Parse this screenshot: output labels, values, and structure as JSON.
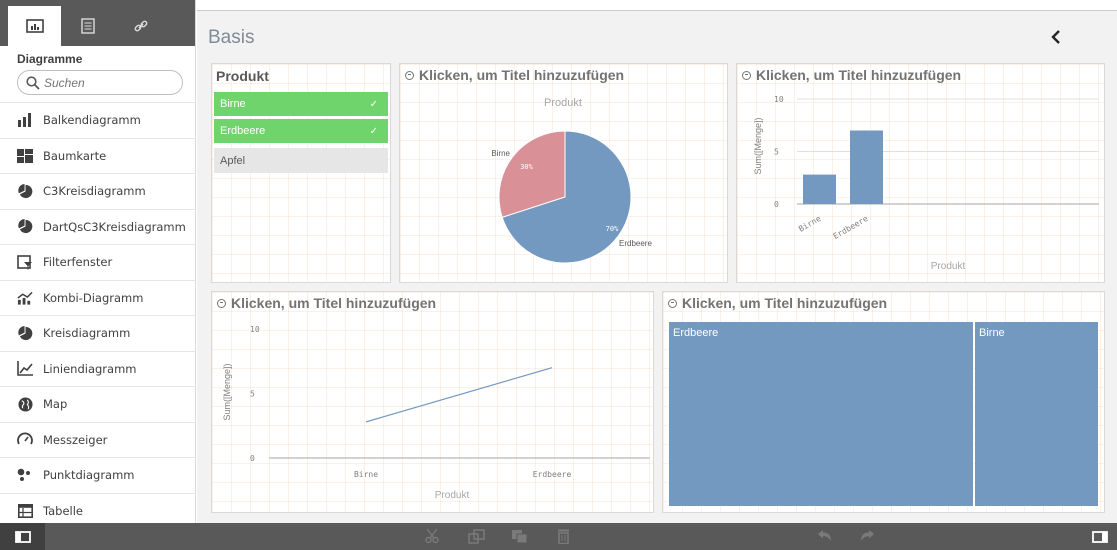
{
  "sidebar": {
    "tabs": [
      "charts-icon",
      "master-items-icon",
      "fields-link-icon"
    ],
    "title": "Diagramme",
    "search_placeholder": "Suchen",
    "items": [
      {
        "label": "Balkendiagramm",
        "icon": "bar-chart-icon"
      },
      {
        "label": "Baumkarte",
        "icon": "treemap-icon"
      },
      {
        "label": "C3Kreisdiagramm",
        "icon": "pie-chart-icon"
      },
      {
        "label": "DartQsC3Kreisdiagramm",
        "icon": "pie-chart-icon"
      },
      {
        "label": "Filterfenster",
        "icon": "filter-pane-icon"
      },
      {
        "label": "Kombi-Diagramm",
        "icon": "combo-chart-icon"
      },
      {
        "label": "Kreisdiagramm",
        "icon": "pie-chart-icon"
      },
      {
        "label": "Liniendiagramm",
        "icon": "line-chart-icon"
      },
      {
        "label": "Map",
        "icon": "globe-icon"
      },
      {
        "label": "Messzeiger",
        "icon": "gauge-icon"
      },
      {
        "label": "Punktdiagramm",
        "icon": "scatter-icon"
      },
      {
        "label": "Tabelle",
        "icon": "table-icon"
      }
    ]
  },
  "sheet": {
    "title": "Basis"
  },
  "filter": {
    "title": "Produkt",
    "rows": [
      {
        "label": "Birne",
        "state": "selected",
        "check": "✓"
      },
      {
        "label": "Erdbeere",
        "state": "selected",
        "check": "✓"
      },
      {
        "label": "Apfel",
        "state": "alternative",
        "check": ""
      }
    ]
  },
  "placeholder_title": "Klicken, um Titel hinzuzufügen",
  "colors": {
    "accent": "#7499c0",
    "pink": "#d99097",
    "selected": "#6fd46c",
    "toolbar": "#595959"
  },
  "chart_data": [
    {
      "type": "pie",
      "title": "Produkt",
      "categories": [
        "Birne",
        "Erdbeere"
      ],
      "values": [
        30,
        70
      ],
      "data_labels": [
        "30%",
        "70%"
      ]
    },
    {
      "type": "bar",
      "categories": [
        "Birne",
        "Erdbeere"
      ],
      "values": [
        2.8,
        7
      ],
      "xlabel": "Produkt",
      "ylabel": "Sum([Menge])",
      "ylim": [
        0,
        10
      ],
      "yticks": [
        "0",
        "5",
        "10"
      ]
    },
    {
      "type": "line",
      "categories": [
        "Birne",
        "Erdbeere"
      ],
      "values": [
        2.8,
        7
      ],
      "xlabel": "Produkt",
      "ylabel": "Sum([Menge])",
      "ylim": [
        0,
        10
      ],
      "yticks": [
        "0",
        "5",
        "10"
      ]
    },
    {
      "type": "treemap",
      "categories": [
        "Erdbeere",
        "Birne"
      ],
      "values": [
        7,
        2.8
      ]
    }
  ],
  "toolbar": {
    "icons": [
      "panel-toggle-icon",
      "cut-icon",
      "copy-icon",
      "paste-icon",
      "delete-icon",
      "undo-icon",
      "redo-icon",
      "properties-toggle-icon"
    ]
  }
}
